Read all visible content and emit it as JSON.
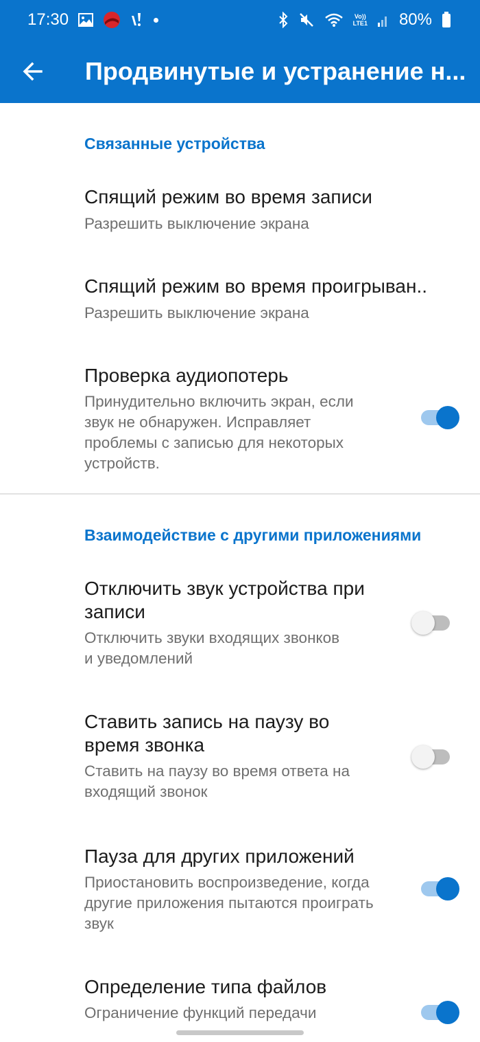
{
  "status_bar": {
    "time": "17:30",
    "battery": "80%",
    "volte_line1": "Vo))",
    "volte_line2": "LTE1"
  },
  "app_bar": {
    "title": "Продвинутые и устранение н..."
  },
  "sections": {
    "linked_devices": {
      "header": "Связанные устройства",
      "sleep_recording": {
        "title": "Спящий режим во время записи",
        "summary": "Разрешить выключение экрана"
      },
      "sleep_playback": {
        "title": "Спящий режим во время проигрыван..",
        "summary": "Разрешить выключение экрана"
      },
      "audio_loss": {
        "title": "Проверка аудиопотерь",
        "summary": "Принудительно включить экран, если звук не обнаружен. Исправляет проблемы с записью для некоторых устройств.",
        "enabled": true
      }
    },
    "other_apps": {
      "header": "Взаимодействие с другими приложениями",
      "mute_device": {
        "title": "Отключить звук устройства при записи",
        "summary": "Отключить звуки входящих звонков и уведомлений",
        "enabled": false
      },
      "pause_on_call": {
        "title": "Ставить запись на паузу во время звонка",
        "summary": "Ставить на паузу во время ответа на входящий звонок",
        "enabled": false
      },
      "pause_other_apps": {
        "title": "Пауза для других приложений",
        "summary": "Приостановить воспроизведение, когда другие приложения пытаются проиграть звук",
        "enabled": true
      },
      "file_type": {
        "title": "Определение типа файлов",
        "summary": "Ограничение функций передачи",
        "enabled": true
      }
    }
  },
  "colors": {
    "accent": "#0a74cc",
    "switch_track_on": "#9ec8ee",
    "switch_track_off": "#bdbdbd"
  }
}
